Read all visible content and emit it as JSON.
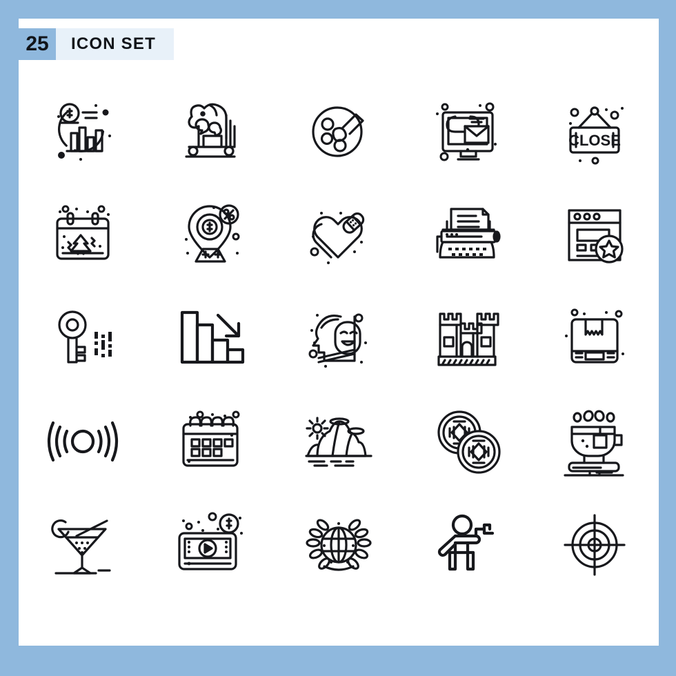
{
  "page": {
    "frame_color": "#8fb8dd",
    "canvas_color": "#ffffff",
    "stroke_color": "#17181c"
  },
  "header": {
    "count": "25",
    "title": "ICON SET",
    "badge_color": "#8fb8dd",
    "title_background": "#e8f1f9"
  },
  "grid": {
    "columns": 5,
    "rows": 5,
    "total_icons": 25
  },
  "icons": [
    {
      "id": 1,
      "name": "financial-analytics-icon",
      "label": "Dollar coin with bar chart"
    },
    {
      "id": 2,
      "name": "trojan-horse-icon",
      "label": "Trojan horse"
    },
    {
      "id": 3,
      "name": "paint-palette-icon",
      "label": "Paint palette with brush"
    },
    {
      "id": 4,
      "name": "email-monitor-icon",
      "label": "Monitor with envelope"
    },
    {
      "id": 5,
      "name": "close-sign-icon",
      "label": "Hanging CLOSE sign",
      "text": "CLOSE"
    },
    {
      "id": 6,
      "name": "christmas-calendar-icon",
      "label": "Calendar with fir tree"
    },
    {
      "id": 7,
      "name": "discount-location-icon",
      "label": "Map pin with dollar and percent"
    },
    {
      "id": 8,
      "name": "healing-heart-icon",
      "label": "Heart with bandage"
    },
    {
      "id": 9,
      "name": "typewriter-icon",
      "label": "Typewriter with paper"
    },
    {
      "id": 10,
      "name": "bookmark-browser-icon",
      "label": "Browser window with star"
    },
    {
      "id": 11,
      "name": "encryption-key-icon",
      "label": "Key with binary code"
    },
    {
      "id": 12,
      "name": "declining-bar-chart-icon",
      "label": "Descending bars with down arrow"
    },
    {
      "id": 13,
      "name": "psychology-mask-icon",
      "label": "Head with smiling mask"
    },
    {
      "id": 14,
      "name": "castle-icon",
      "label": "Castle fortress"
    },
    {
      "id": 15,
      "name": "package-box-icon",
      "label": "Cardboard delivery box"
    },
    {
      "id": 16,
      "name": "vibration-signal-icon",
      "label": "Circle with sound waves"
    },
    {
      "id": 17,
      "name": "spiral-calendar-icon",
      "label": "Spiral bound calendar"
    },
    {
      "id": 18,
      "name": "mountain-landscape-icon",
      "label": "Mountains with sun and clouds"
    },
    {
      "id": 19,
      "name": "chinese-coins-icon",
      "label": "Two oriental coins"
    },
    {
      "id": 20,
      "name": "teacup-icon",
      "label": "Teacup with tea bag"
    },
    {
      "id": 21,
      "name": "cocktail-glass-icon",
      "label": "Martini cocktail glass"
    },
    {
      "id": 22,
      "name": "video-monetization-icon",
      "label": "Video player with dollar coin"
    },
    {
      "id": 23,
      "name": "global-award-icon",
      "label": "Globe with laurel wreath"
    },
    {
      "id": 24,
      "name": "shooter-person-icon",
      "label": "Person aiming a gun"
    },
    {
      "id": 25,
      "name": "crosshair-target-icon",
      "label": "Target crosshair"
    }
  ]
}
